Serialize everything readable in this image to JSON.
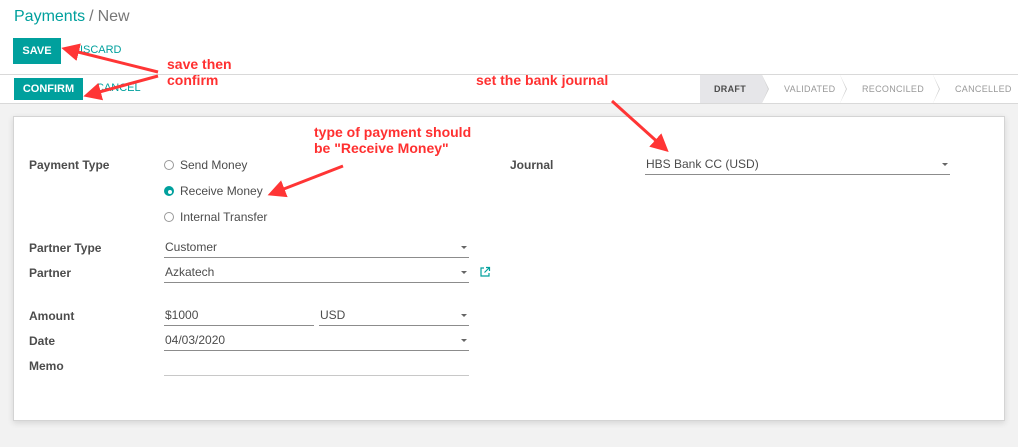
{
  "breadcrumb": {
    "parent": "Payments",
    "separator": "/",
    "current": "New"
  },
  "toolbar": {
    "save_label": "SAVE",
    "discard_label": "DISCARD"
  },
  "statusbar": {
    "confirm_label": "CONFIRM",
    "cancel_label": "CANCEL",
    "stages": [
      "DRAFT",
      "VALIDATED",
      "RECONCILED",
      "CANCELLED"
    ],
    "active_stage": "DRAFT"
  },
  "form": {
    "payment_type": {
      "label": "Payment Type",
      "options": [
        "Send Money",
        "Receive Money",
        "Internal Transfer"
      ],
      "selected": "Receive Money"
    },
    "partner_type": {
      "label": "Partner Type",
      "value": "Customer"
    },
    "partner": {
      "label": "Partner",
      "value": "Azkatech"
    },
    "amount": {
      "label": "Amount",
      "value": "$1000",
      "currency": "USD"
    },
    "date": {
      "label": "Date",
      "value": "04/03/2020"
    },
    "memo": {
      "label": "Memo",
      "value": ""
    },
    "journal": {
      "label": "Journal",
      "value": "HBS Bank CC (USD)"
    }
  },
  "annotations": {
    "save_confirm": [
      "save then",
      "confirm"
    ],
    "payment_type": [
      "type of payment should",
      "be \"Receive Money\""
    ],
    "journal": "set the bank journal"
  },
  "colors": {
    "primary": "#00a09d",
    "annotation": "#ff3030",
    "active_stage_bg": "#e6e6e9"
  }
}
